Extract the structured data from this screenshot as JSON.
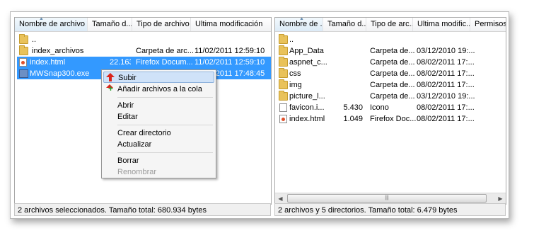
{
  "left_pane": {
    "columns": [
      "Nombre de archivo",
      "Tamaño d...",
      "Tipo de archivo",
      "Ultima modificación"
    ],
    "rows": [
      {
        "icon": "folder-icon",
        "name": "..",
        "size": "",
        "type": "",
        "modified": "",
        "selected": false
      },
      {
        "icon": "folder-icon",
        "name": "index_archivos",
        "size": "",
        "type": "Carpeta de arc...",
        "modified": "11/02/2011 12:59:10",
        "selected": false
      },
      {
        "icon": "html-file-icon",
        "name": "index.html",
        "size": "22.163",
        "type": "Firefox Docum...",
        "modified": "11/02/2011 12:59:10",
        "selected": true
      },
      {
        "icon": "exe-file-icon",
        "name": "MWSnap300.exe",
        "size": "",
        "type": "",
        "modified": "11/02/2011 17:48:45",
        "selected": true
      }
    ],
    "status": "2 archivos seleccionados. Tamaño total: 680.934 bytes"
  },
  "right_pane": {
    "columns": [
      "Nombre de ...",
      "Tamaño d...",
      "Tipo de arc...",
      "Ultima modific...",
      "Permisos"
    ],
    "rows": [
      {
        "icon": "folder-icon",
        "name": "..",
        "size": "",
        "type": "",
        "modified": ""
      },
      {
        "icon": "folder-icon",
        "name": "App_Data",
        "size": "",
        "type": "Carpeta de...",
        "modified": "03/12/2010 19:..."
      },
      {
        "icon": "folder-icon",
        "name": "aspnet_c...",
        "size": "",
        "type": "Carpeta de...",
        "modified": "08/02/2011 17:..."
      },
      {
        "icon": "folder-icon",
        "name": "css",
        "size": "",
        "type": "Carpeta de...",
        "modified": "08/02/2011 17:..."
      },
      {
        "icon": "folder-icon",
        "name": "img",
        "size": "",
        "type": "Carpeta de...",
        "modified": "08/02/2011 17:..."
      },
      {
        "icon": "folder-icon",
        "name": "picture_l...",
        "size": "",
        "type": "Carpeta de...",
        "modified": "03/12/2010 19:..."
      },
      {
        "icon": "file-icon",
        "name": "favicon.i...",
        "size": "5.430",
        "type": "Icono",
        "modified": "08/02/2011 17:..."
      },
      {
        "icon": "html-file-icon",
        "name": "index.html",
        "size": "1.049",
        "type": "Firefox Doc...",
        "modified": "08/02/2011 17:..."
      }
    ],
    "status": "2 archivos y 5 directorios. Tamaño total: 6.479 bytes"
  },
  "context_menu": {
    "items": [
      {
        "label": "Subir",
        "icon": "upload-arrow-icon",
        "highlighted": true,
        "disabled": false
      },
      {
        "label": "Añadir archivos a la cola",
        "icon": "add-to-queue-icon",
        "highlighted": false,
        "disabled": false
      },
      {
        "label": "Abrir",
        "icon": "",
        "highlighted": false,
        "disabled": false
      },
      {
        "label": "Editar",
        "icon": "",
        "highlighted": false,
        "disabled": false
      },
      {
        "label": "Crear directorio",
        "icon": "",
        "highlighted": false,
        "disabled": false
      },
      {
        "label": "Actualizar",
        "icon": "",
        "highlighted": false,
        "disabled": false
      },
      {
        "label": "Borrar",
        "icon": "",
        "highlighted": false,
        "disabled": false
      },
      {
        "label": "Renombrar",
        "icon": "",
        "highlighted": false,
        "disabled": true
      }
    ]
  },
  "colors": {
    "selection": "#3399ff",
    "menu_highlight": "#cfe2f8",
    "folder": "#e9c25a"
  }
}
